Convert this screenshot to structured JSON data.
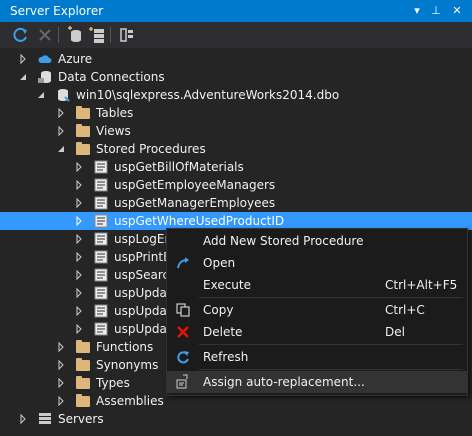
{
  "window": {
    "title": "Server Explorer"
  },
  "title_buttons": {
    "dropdown": "▾",
    "pin": "⊥",
    "close": "✕"
  },
  "tree": [
    {
      "label": "Azure"
    },
    {
      "label": "Data Connections"
    },
    {
      "label": "win10\\sqlexpress.AdventureWorks2014.dbo"
    },
    {
      "label": "Tables"
    },
    {
      "label": "Views"
    },
    {
      "label": "Stored Procedures"
    },
    {
      "label": "uspGetBillOfMaterials"
    },
    {
      "label": "uspGetEmployeeManagers"
    },
    {
      "label": "uspGetManagerEmployees"
    },
    {
      "label": "uspGetWhereUsedProductID"
    },
    {
      "label": "uspLogEr"
    },
    {
      "label": "uspPrintE"
    },
    {
      "label": "uspSearch"
    },
    {
      "label": "uspUpdat"
    },
    {
      "label": "uspUpdat"
    },
    {
      "label": "uspUpdat"
    },
    {
      "label": "Functions"
    },
    {
      "label": "Synonyms"
    },
    {
      "label": "Types"
    },
    {
      "label": "Assemblies"
    },
    {
      "label": "Servers"
    }
  ],
  "context_menu": {
    "items": [
      {
        "label": "Add New Stored Procedure",
        "shortcut": ""
      },
      {
        "label": "Open",
        "shortcut": ""
      },
      {
        "label": "Execute",
        "shortcut": "Ctrl+Alt+F5"
      },
      {
        "label": "Copy",
        "shortcut": "Ctrl+C"
      },
      {
        "label": "Delete",
        "shortcut": "Del"
      },
      {
        "label": "Refresh",
        "shortcut": ""
      },
      {
        "label": "Assign auto-replacement...",
        "shortcut": ""
      }
    ]
  },
  "colors": {
    "accent": "#007acc",
    "selection": "#3399ff",
    "background": "#252526",
    "folder": "#dcb67a",
    "delete": "#e51400",
    "refresh": "#3c9ee8"
  }
}
